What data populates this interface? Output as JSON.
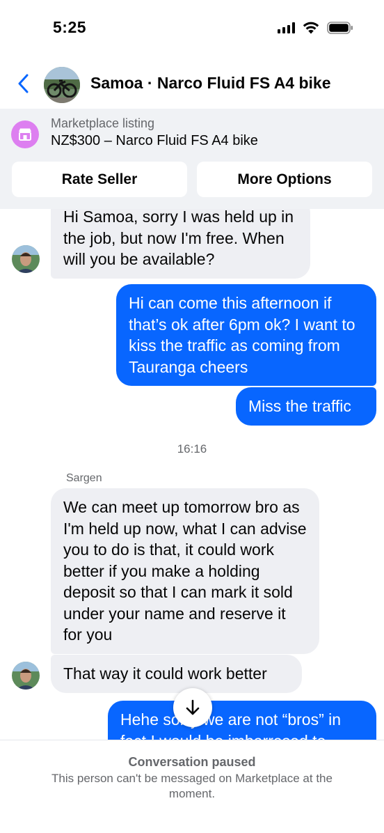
{
  "status_bar": {
    "time": "5:25"
  },
  "header": {
    "title": "Samoa · Narco Fluid FS A4 bike"
  },
  "listing": {
    "kicker": "Marketplace listing",
    "title": "NZ$300 – Narco Fluid FS A4 bike",
    "rate_seller_label": "Rate Seller",
    "more_options_label": "More Options"
  },
  "messages": {
    "m1": "Hi Samoa, sorry I was held up in the job, but  now I'm free. When will you be available?",
    "m2": "Hi can come this afternoon if that’s ok after 6pm ok? I want to kiss the traffic as coming from Tauranga cheers",
    "m3": "Miss the traffic",
    "timestamp": "16:16",
    "sender": "Sargen",
    "m4": "We can meet up tomorrow bro as I'm held up now, what I can advise you to do is that,  it could work better if you make a holding deposit so that I can mark it sold under your name and reserve it for you",
    "m5": "That way it could work better",
    "m6": "Hehe sorry we are not “bros” in fact I would be imbarresed to"
  },
  "footer": {
    "title": "Conversation paused",
    "description": "This person can't be messaged on Marketplace at the moment."
  },
  "colors": {
    "accent": "#0866ff",
    "received_bubble": "#eeeff3",
    "listing_icon": "#dd7ff0"
  },
  "icons": [
    "back-chevron-icon",
    "shop-icon",
    "arrow-down-icon",
    "signal-icon",
    "wifi-icon",
    "battery-icon"
  ]
}
